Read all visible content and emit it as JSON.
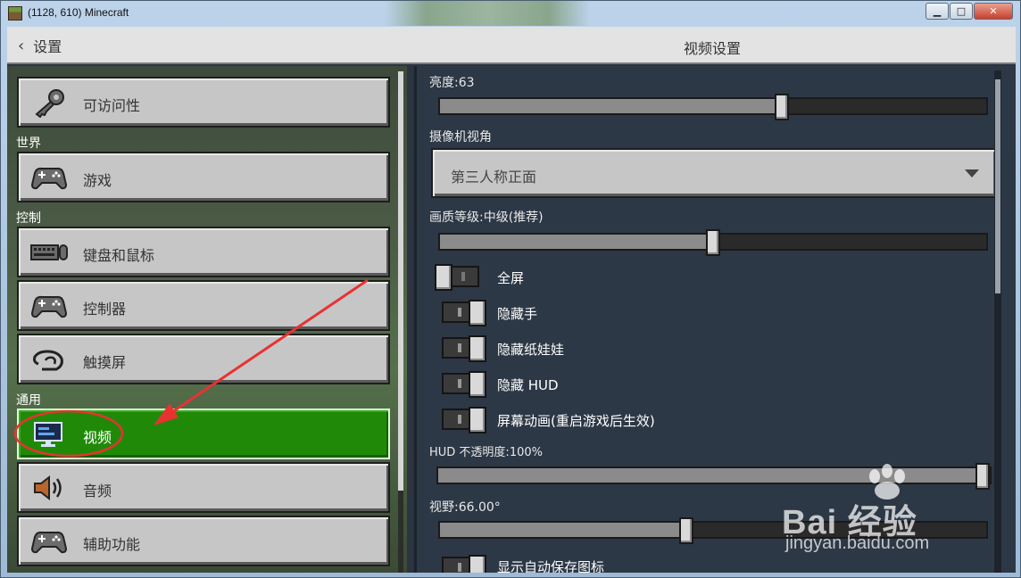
{
  "window": {
    "title": "(1128, 610) Minecraft",
    "controls": {
      "minimize": "▁",
      "maximize": "□",
      "close": "✕"
    }
  },
  "header": {
    "back_label": "设置",
    "title": "视频设置"
  },
  "sidebar": {
    "categories": {
      "world": "世界",
      "controls": "控制",
      "general": "通用"
    },
    "items": [
      {
        "label": "可访问性",
        "icon": "key-icon"
      },
      {
        "label": "游戏",
        "icon": "controller-icon"
      },
      {
        "label": "键盘和鼠标",
        "icon": "keyboard-mouse-icon"
      },
      {
        "label": "控制器",
        "icon": "controller-icon"
      },
      {
        "label": "触摸屏",
        "icon": "touch-icon"
      },
      {
        "label": "视频",
        "icon": "monitor-icon",
        "selected": true
      },
      {
        "label": "音频",
        "icon": "speaker-icon"
      },
      {
        "label": "辅助功能",
        "icon": "controller-icon"
      }
    ]
  },
  "settings": {
    "brightness": {
      "label": "亮度:63",
      "value": 0.63
    },
    "camera": {
      "label": "摄像机视角",
      "value": "第三人称正面"
    },
    "graphics": {
      "label": "画质等级:中级(推荐)",
      "value": 0.5
    },
    "toggles": [
      {
        "label": "全屏",
        "on": false
      },
      {
        "label": "隐藏手",
        "on": true
      },
      {
        "label": "隐藏纸娃娃",
        "on": true
      },
      {
        "label": "隐藏 HUD",
        "on": true
      },
      {
        "label": "屏幕动画(重启游戏后生效)",
        "on": true
      }
    ],
    "hud_opacity": {
      "label": "HUD 不透明度:100%",
      "value": 1.0
    },
    "fov": {
      "label": "视野:66.00°",
      "value": 0.45
    },
    "autosave_icon": {
      "label": "显示自动保存图标"
    }
  },
  "watermark": {
    "brand": "Bai 经验",
    "url": "jingyan.baidu.com"
  },
  "colors": {
    "selected": "#208a08",
    "annotation": "#e83232"
  }
}
